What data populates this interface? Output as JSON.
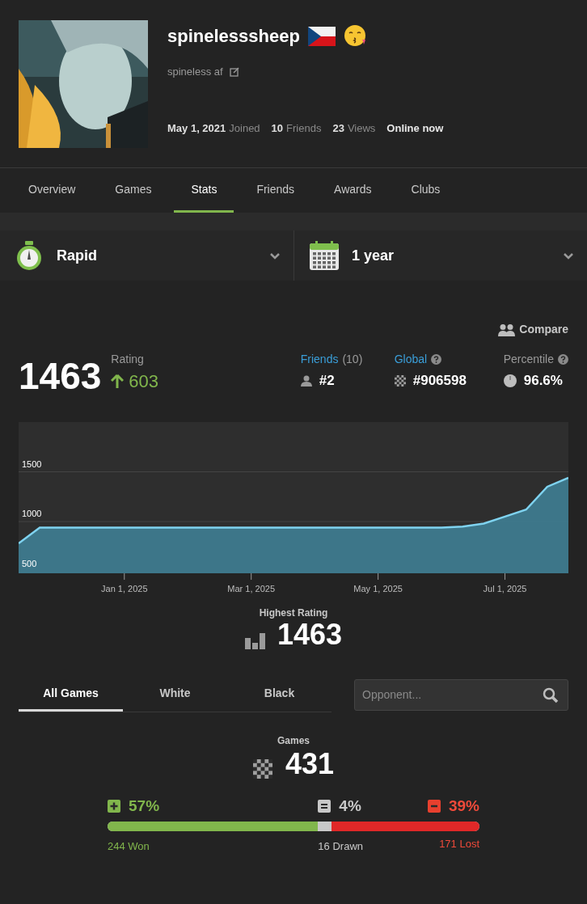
{
  "profile": {
    "username": "spinelesssheep",
    "status": "spineless af",
    "joined": {
      "value": "May 1, 2021",
      "label": "Joined"
    },
    "friends": {
      "value": "10",
      "label": "Friends"
    },
    "views": {
      "value": "23",
      "label": "Views"
    },
    "online": "Online now"
  },
  "tabs": [
    {
      "label": "Overview",
      "selected": false
    },
    {
      "label": "Games",
      "selected": false
    },
    {
      "label": "Stats",
      "selected": true
    },
    {
      "label": "Friends",
      "selected": false
    },
    {
      "label": "Awards",
      "selected": false
    },
    {
      "label": "Clubs",
      "selected": false
    }
  ],
  "filters": [
    {
      "kind": "stopwatch",
      "label": "Rapid"
    },
    {
      "kind": "calendar",
      "label": "1 year"
    }
  ],
  "compare": "Compare",
  "rating": {
    "value": "1463",
    "label": "Rating",
    "change": "603"
  },
  "ranks": [
    {
      "kind": "friends",
      "label": "Friends",
      "count": "(10)",
      "value": "#2"
    },
    {
      "kind": "global",
      "label": "Global",
      "value": "#906598"
    },
    {
      "kind": "percentile",
      "label": "Percentile",
      "value": "96.6%"
    }
  ],
  "chart_data": {
    "type": "area",
    "ylim": [
      480,
      2000
    ],
    "yticks": [
      500,
      1000,
      1500
    ],
    "categories": [
      null,
      null,
      null,
      null,
      null,
      "Jan 1, 2025",
      null,
      null,
      null,
      null,
      null,
      "Mar 1, 2025",
      null,
      null,
      null,
      null,
      null,
      "May 1, 2025",
      null,
      null,
      null,
      null,
      null,
      "Jul 1, 2025",
      null,
      null,
      null
    ],
    "series": [
      {
        "color": "#7fd3f0",
        "values": [
          780,
          940,
          940,
          940,
          940,
          940,
          940,
          940,
          940,
          940,
          940,
          940,
          940,
          940,
          940,
          940,
          940,
          940,
          940,
          940,
          940,
          950,
          980,
          1050,
          1120,
          1350,
          1440
        ]
      }
    ]
  },
  "highest": {
    "label": "Highest Rating",
    "value": "1463"
  },
  "color_tabs": [
    {
      "label": "All Games",
      "selected": true
    },
    {
      "label": "White",
      "selected": false
    },
    {
      "label": "Black",
      "selected": false
    }
  ],
  "opponent_search": {
    "placeholder": "Opponent..."
  },
  "games": {
    "label": "Games",
    "value": "431"
  },
  "results": [
    {
      "kind": "won",
      "percent": "57%",
      "caption": "244 Won",
      "level": 0.566
    },
    {
      "kind": "drawn",
      "percent": "4%",
      "caption": "16 Drawn"
    },
    {
      "kind": "lost",
      "percent": "39%",
      "caption": "171 Lost",
      "level": 0.397
    }
  ]
}
